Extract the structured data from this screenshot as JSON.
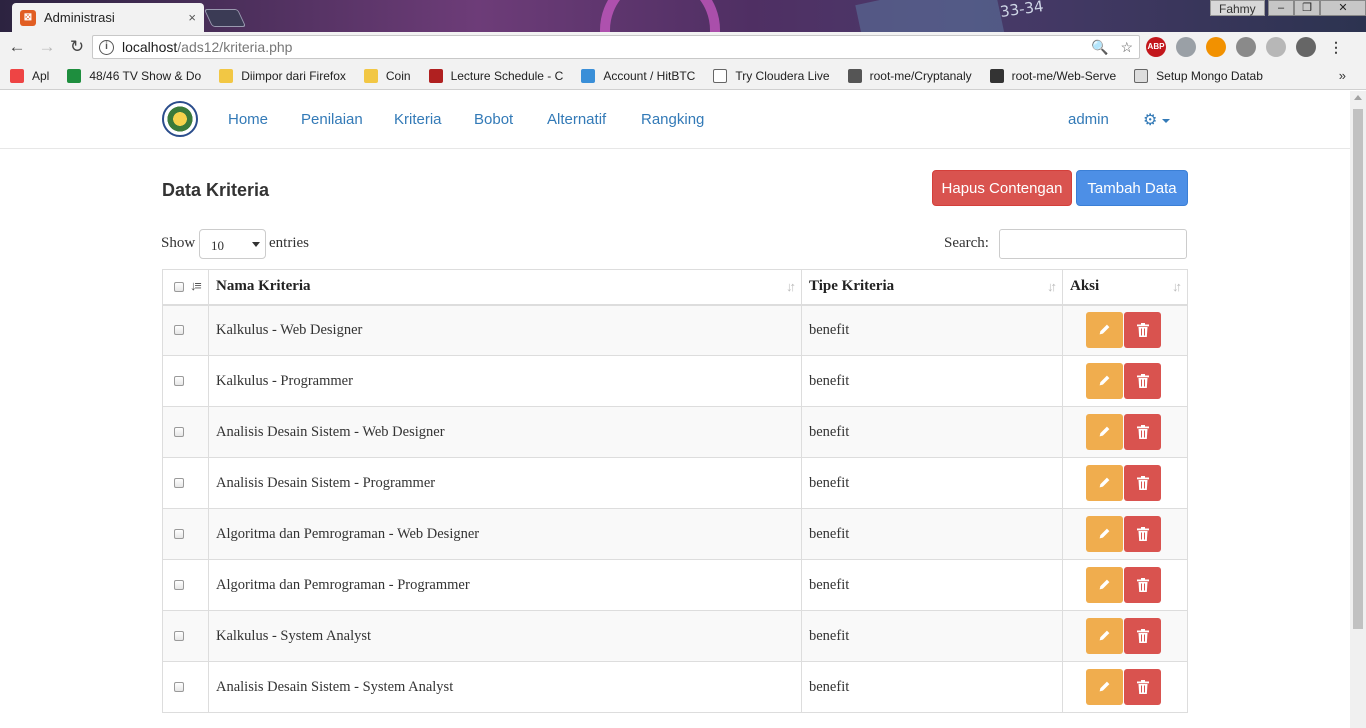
{
  "browser": {
    "tab_title": "Administrasi",
    "tab_close": "×",
    "user": "Fahmy",
    "url_host": "localhost",
    "url_path": "/ads12/kriteria.php",
    "bookmarks": [
      {
        "label": "Apl",
        "icon": "apps-grid-icon",
        "color": "#e44"
      },
      {
        "label": "48/46 TV Show & Do",
        "icon": "sheets-icon",
        "color": "#1e8e3e"
      },
      {
        "label": "Diimpor dari Firefox",
        "icon": "folder-icon",
        "color": "#f2c744"
      },
      {
        "label": "Coin",
        "icon": "folder-icon",
        "color": "#f2c744"
      },
      {
        "label": "Lecture Schedule - C",
        "icon": "apple-icon",
        "color": "#b02020"
      },
      {
        "label": "Account / HitBTC",
        "icon": "bird-icon",
        "color": "#3a8fd8"
      },
      {
        "label": "Try Cloudera Live",
        "icon": "page-icon",
        "color": "#ffffff"
      },
      {
        "label": "root-me/Cryptanaly",
        "icon": "skull-icon",
        "color": "#555555"
      },
      {
        "label": "root-me/Web-Serve",
        "icon": "github-icon",
        "color": "#333333"
      },
      {
        "label": "Setup Mongo Datab",
        "icon": "page-icon",
        "color": "#dddddd"
      }
    ],
    "more": "»"
  },
  "navbar": {
    "links": [
      "Home",
      "Penilaian",
      "Kriteria",
      "Bobot",
      "Alternatif",
      "Rangking"
    ],
    "user": "admin",
    "settings_icon": "gear-icon"
  },
  "content": {
    "title": "Data Kriteria",
    "btn_delete_checked": "Hapus Contengan",
    "btn_add": "Tambah Data",
    "show_label": "Show",
    "entries_label": "entries",
    "page_length": "10",
    "search_label": "Search:",
    "search_value": "",
    "columns": [
      "Nama Kriteria",
      "Tipe Kriteria",
      "Aksi"
    ],
    "rows": [
      {
        "nama": "Kalkulus - Web Designer",
        "tipe": "benefit"
      },
      {
        "nama": "Kalkulus - Programmer",
        "tipe": "benefit"
      },
      {
        "nama": "Analisis Desain Sistem - Web Designer",
        "tipe": "benefit"
      },
      {
        "nama": "Analisis Desain Sistem - Programmer",
        "tipe": "benefit"
      },
      {
        "nama": "Algoritma dan Pemrograman - Web Designer",
        "tipe": "benefit"
      },
      {
        "nama": "Algoritma dan Pemrograman - Programmer",
        "tipe": "benefit"
      },
      {
        "nama": "Kalkulus - System Analyst",
        "tipe": "benefit"
      },
      {
        "nama": "Analisis Desain Sistem - System Analyst",
        "tipe": "benefit"
      }
    ],
    "colors": {
      "danger": "#d9534f",
      "warning": "#f0ad4e",
      "primary": "#4d8fe6",
      "link": "#337ab7"
    }
  }
}
